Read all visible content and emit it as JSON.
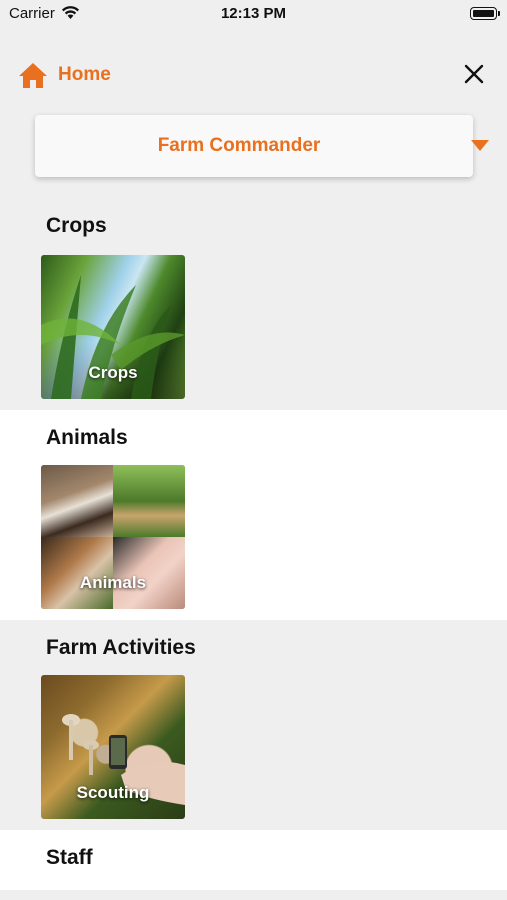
{
  "status_bar": {
    "carrier": "Carrier",
    "time": "12:13 PM"
  },
  "header": {
    "home_label": "Home"
  },
  "dropdown": {
    "selected": "Farm Commander"
  },
  "colors": {
    "accent": "#e8701e",
    "background_gray": "#efefef",
    "background_white": "#ffffff"
  },
  "icons": [
    "wifi-icon",
    "battery-icon",
    "home-icon",
    "close-icon",
    "caret-down-icon"
  ],
  "sections": [
    {
      "title": "Crops",
      "tile_label": "Crops"
    },
    {
      "title": "Animals",
      "tile_label": "Animals"
    },
    {
      "title": "Farm Activities",
      "tile_label": "Scouting"
    },
    {
      "title": "Staff"
    }
  ]
}
